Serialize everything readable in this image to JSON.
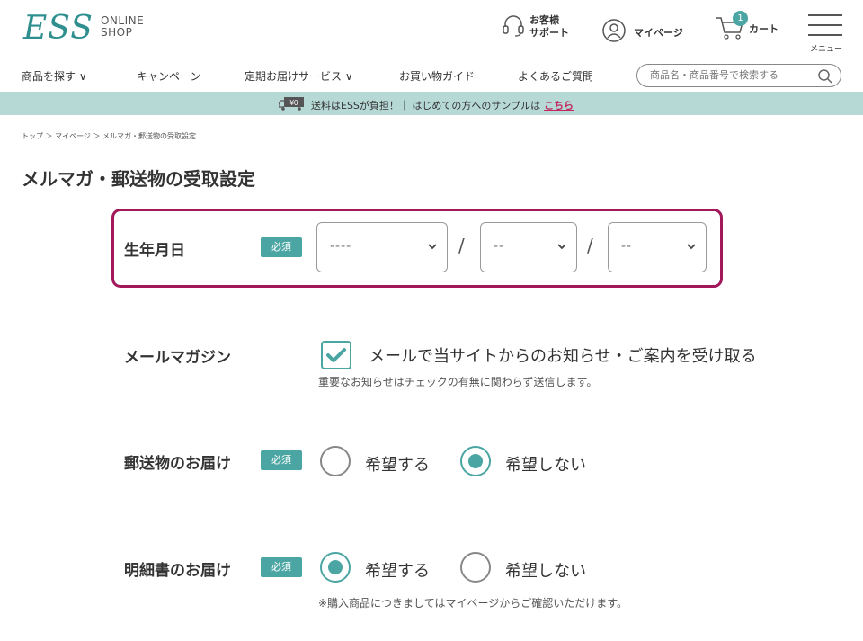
{
  "header": {
    "logo": "ESS",
    "logo_sub_1": "ONLINE",
    "logo_sub_2": "SHOP",
    "support_1": "お客様",
    "support_2": "サポート",
    "mypage": "マイページ",
    "cart": "カート",
    "cart_count": "1",
    "menu": "メニュー"
  },
  "nav": {
    "items": [
      "商品を探す ∨",
      "キャンペーン",
      "定期お届けサービス ∨",
      "お買い物ガイド",
      "よくあるご質問"
    ],
    "search_placeholder": "商品名・商品番号で検索する"
  },
  "banner": {
    "text": "送料はESSが負担！｜ はじめての方へのサンプルは",
    "link": "こちら"
  },
  "breadcrumb": "トップ ＞ マイページ ＞ メルマガ・郵送物の受取設定",
  "title": "メルマガ・郵送物の受取設定",
  "form": {
    "required_label": "必須",
    "birthday": {
      "label": "生年月日",
      "year": "----",
      "month": "--",
      "day": "--",
      "separator": "/"
    },
    "mailmag": {
      "label": "メールマガジン",
      "checkbox_label": "メールで当サイトからのお知らせ・ご案内を受け取る",
      "checked": true,
      "note": "重要なお知らせはチェックの有無に関わらず送信します。"
    },
    "postal": {
      "label": "郵送物のお届け",
      "option_yes": "希望する",
      "option_no": "希望しない",
      "selected": "no"
    },
    "statement": {
      "label": "明細書のお届け",
      "option_yes": "希望する",
      "option_no": "希望しない",
      "selected": "yes",
      "note": "※購入商品につきましてはマイページからご確認いただけます。"
    }
  },
  "colors": {
    "accent": "#4ba6a3",
    "highlight_border": "#a2185b",
    "banner_bg": "#b7d9d6",
    "link": "#c0265c"
  }
}
